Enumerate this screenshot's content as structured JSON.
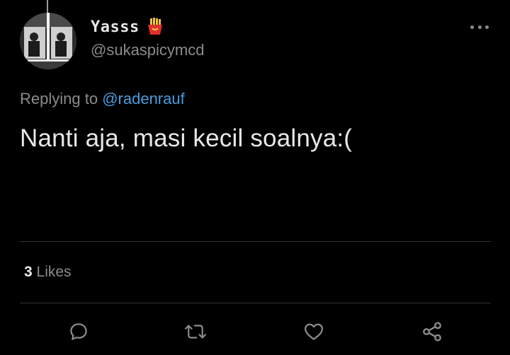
{
  "tweet": {
    "display_name": "Yasss",
    "handle": "@sukaspicymcd",
    "replying_prefix": "Replying to",
    "replying_to": "@radenrauf",
    "text": "Nanti aja, masi kecil soalnya:(",
    "likes_count": "3",
    "likes_label": "Likes"
  },
  "icons": {
    "name_emoji": "fries-icon",
    "menu": "more-icon",
    "actions": [
      "reply-icon",
      "retweet-icon",
      "like-icon",
      "share-icon"
    ]
  },
  "colors": {
    "background": "#000000",
    "text_primary": "#e7e7e7",
    "text_secondary": "#8b8b8b",
    "link": "#4a9ce0"
  }
}
